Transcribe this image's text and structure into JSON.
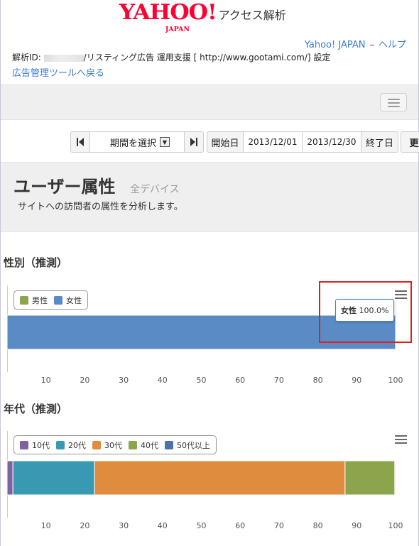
{
  "header": {
    "logo_text": "YAHOO!",
    "logo_sub": "JAPAN",
    "app_title": "アクセス解析",
    "links": {
      "yahoo": "Yahoo! JAPAN",
      "sep": "–",
      "help": "ヘルプ"
    },
    "info_prefix": "解析ID:",
    "info_suffix": "/リスティング広告 運用支援 [ http://www.gootami.com/]  設定",
    "back_link": "広告管理ツールへ戻る"
  },
  "toolbar": {
    "prev_icon": "skip-previous-icon",
    "period_label": "期間を選択",
    "next_icon": "skip-next-icon",
    "start_label": "開始日",
    "start_date": "2013/12/01",
    "end_date": "2013/12/30",
    "end_label": "終了日",
    "update_label": "更新"
  },
  "page": {
    "title": "ユーザー属性",
    "subtitle": "全デバイス",
    "description": "サイトへの訪問者の属性を分析します。"
  },
  "sections": {
    "gender_title": "性別（推測）",
    "age_title": "年代（推測）"
  },
  "tooltip": {
    "label": "女性",
    "value": "100.0%"
  },
  "chart_data": [
    {
      "type": "bar",
      "orientation": "horizontal",
      "stacked": true,
      "x_ticks": [
        "10",
        "20",
        "30",
        "40",
        "50",
        "60",
        "70",
        "80",
        "90",
        "100"
      ],
      "xlim": [
        0,
        100
      ],
      "series": [
        {
          "name": "男性",
          "color": "#8ca54d",
          "values": [
            0
          ]
        },
        {
          "name": "女性",
          "color": "#5b8bc5",
          "values": [
            100
          ]
        }
      ],
      "legend": "top-left",
      "grid": false
    },
    {
      "type": "bar",
      "orientation": "horizontal",
      "stacked": true,
      "x_ticks": [
        "10",
        "20",
        "30",
        "40",
        "50",
        "60",
        "70",
        "80",
        "90",
        "100"
      ],
      "xlim": [
        0,
        100
      ],
      "series": [
        {
          "name": "10代",
          "color": "#7f62a0",
          "values": [
            1.5
          ]
        },
        {
          "name": "20代",
          "color": "#3998b2",
          "values": [
            21
          ]
        },
        {
          "name": "30代",
          "color": "#e08c3e",
          "values": [
            64.5
          ]
        },
        {
          "name": "40代",
          "color": "#8ca54d",
          "values": [
            12.8
          ]
        },
        {
          "name": "50代以上",
          "color": "#4a73ad",
          "values": [
            0.2
          ]
        }
      ],
      "legend": "top-left",
      "grid": false
    }
  ]
}
